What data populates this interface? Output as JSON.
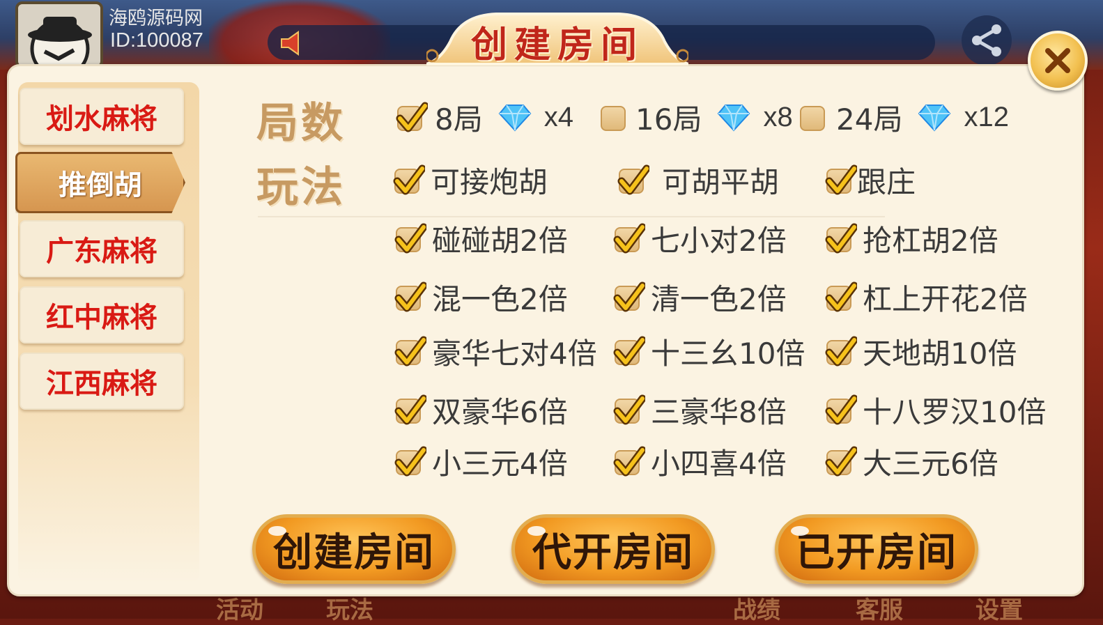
{
  "user": {
    "name": "海鸥源码网",
    "id": "ID:100087"
  },
  "dialog": {
    "title": "创建房间",
    "close_icon": "close-x-icon"
  },
  "colors": {
    "accent_red": "#d91a14",
    "panel_bg": "#fbf3e2",
    "button_orange": "#f29a22",
    "label_gold": "#c79a62"
  },
  "sidebar": {
    "items": [
      {
        "label": "划水麻将",
        "active": false
      },
      {
        "label": "推倒胡",
        "active": true
      },
      {
        "label": "广东麻将",
        "active": false
      },
      {
        "label": "红中麻将",
        "active": false
      },
      {
        "label": "江西麻将",
        "active": false
      }
    ]
  },
  "rounds": {
    "label": "局数",
    "options": [
      {
        "label": "8局",
        "cost": "x4",
        "checked": true
      },
      {
        "label": "16局",
        "cost": "x8",
        "checked": false
      },
      {
        "label": "24局",
        "cost": "x12",
        "checked": false
      }
    ]
  },
  "rules": {
    "label": "玩法",
    "options": [
      {
        "label": "可接炮胡",
        "checked": true
      },
      {
        "label": "可胡平胡",
        "checked": true
      },
      {
        "label": "跟庄",
        "checked": true
      },
      {
        "label": "碰碰胡2倍",
        "checked": true
      },
      {
        "label": "七小对2倍",
        "checked": true
      },
      {
        "label": "抢杠胡2倍",
        "checked": true
      },
      {
        "label": "混一色2倍",
        "checked": true
      },
      {
        "label": "清一色2倍",
        "checked": true
      },
      {
        "label": "杠上开花2倍",
        "checked": true
      },
      {
        "label": "豪华七对4倍",
        "checked": true
      },
      {
        "label": "十三幺10倍",
        "checked": true
      },
      {
        "label": "天地胡10倍",
        "checked": true
      },
      {
        "label": "双豪华6倍",
        "checked": true
      },
      {
        "label": "三豪华8倍",
        "checked": true
      },
      {
        "label": "十八罗汉10倍",
        "checked": true
      },
      {
        "label": "小三元4倍",
        "checked": true
      },
      {
        "label": "小四喜4倍",
        "checked": true
      },
      {
        "label": "大三元6倍",
        "checked": true
      }
    ]
  },
  "buttons": {
    "create": "创建房间",
    "proxy": "代开房间",
    "opened": "已开房间"
  },
  "bottom_nav": {
    "items": [
      "活动",
      "玩法",
      "战绩",
      "客服",
      "设置"
    ]
  }
}
